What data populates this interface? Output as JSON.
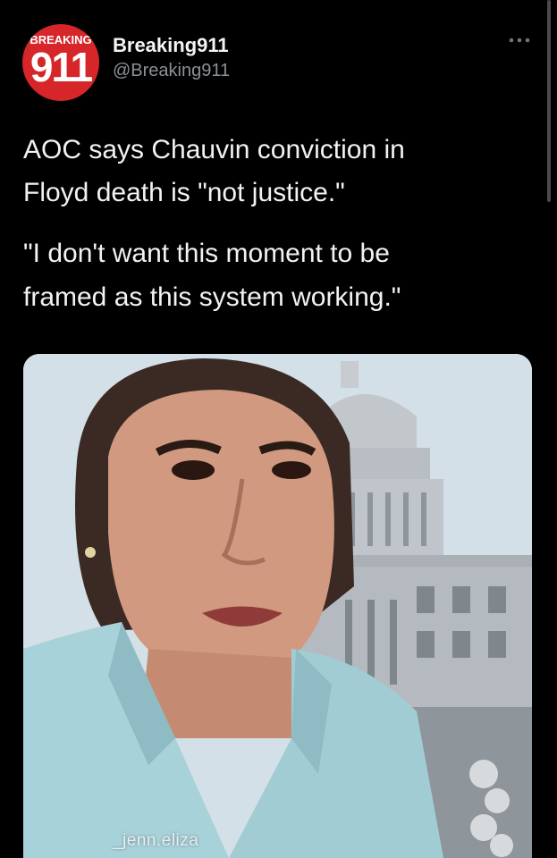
{
  "tweet": {
    "avatar": {
      "top_text": "BREAKING",
      "number": "911",
      "brand_color": "#d6262a"
    },
    "author": {
      "display_name": "Breaking911",
      "handle": "@Breaking911"
    },
    "more_icon": "more-dots-icon",
    "text_lines": [
      "AOC says Chauvin conviction in",
      "Floyd death is \"not justice.\"",
      "\"I don't want this moment to be",
      "framed as this system working.\""
    ],
    "media": {
      "watermark": "_jenn.eliza"
    }
  }
}
